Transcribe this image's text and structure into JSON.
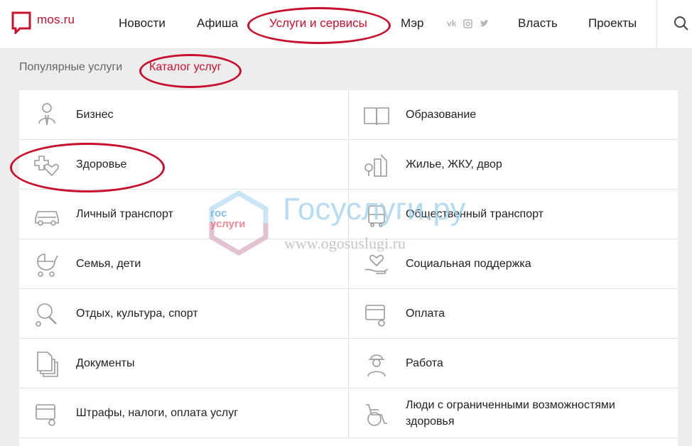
{
  "header": {
    "logo_text": "mos.ru",
    "nav": [
      {
        "label": "Новости"
      },
      {
        "label": "Афиша"
      },
      {
        "label": "Услуги и сервисы"
      },
      {
        "label": "Мэр"
      },
      {
        "label": "Власть"
      },
      {
        "label": "Проекты"
      }
    ],
    "social": [
      "vk",
      "ig",
      "tw"
    ]
  },
  "breadcrumbs": {
    "popular": "Популярные услуги",
    "catalog": "Каталог услуг"
  },
  "catalog": {
    "items": [
      {
        "label": "Бизнес",
        "icon": "business-icon"
      },
      {
        "label": "Образование",
        "icon": "book-icon"
      },
      {
        "label": "Здоровье",
        "icon": "health-icon"
      },
      {
        "label": "Жилье, ЖКУ, двор",
        "icon": "housing-icon"
      },
      {
        "label": "Личный транспорт",
        "icon": "car-icon"
      },
      {
        "label": "Общественный транспорт",
        "icon": "bus-icon"
      },
      {
        "label": "Семья, дети",
        "icon": "stroller-icon"
      },
      {
        "label": "Социальная поддержка",
        "icon": "heart-hand-icon"
      },
      {
        "label": "Отдых, культура, спорт",
        "icon": "ping-pong-icon"
      },
      {
        "label": "Оплата",
        "icon": "wallet-icon"
      },
      {
        "label": "Документы",
        "icon": "documents-icon"
      },
      {
        "label": "Работа",
        "icon": "worker-icon"
      },
      {
        "label": "Штрафы, налоги, оплата услуг",
        "icon": "fines-icon"
      },
      {
        "label": "Люди с ограниченными возможностями здоровья",
        "icon": "wheelchair-icon"
      }
    ]
  },
  "watermark": {
    "title": "Госуслуги.ру",
    "url": "www.ogosuslugi.ru",
    "logo_top": "гос",
    "logo_bottom": "услуги"
  },
  "colors": {
    "accent": "#c8102e",
    "icon_gray": "#9a9a9a"
  }
}
